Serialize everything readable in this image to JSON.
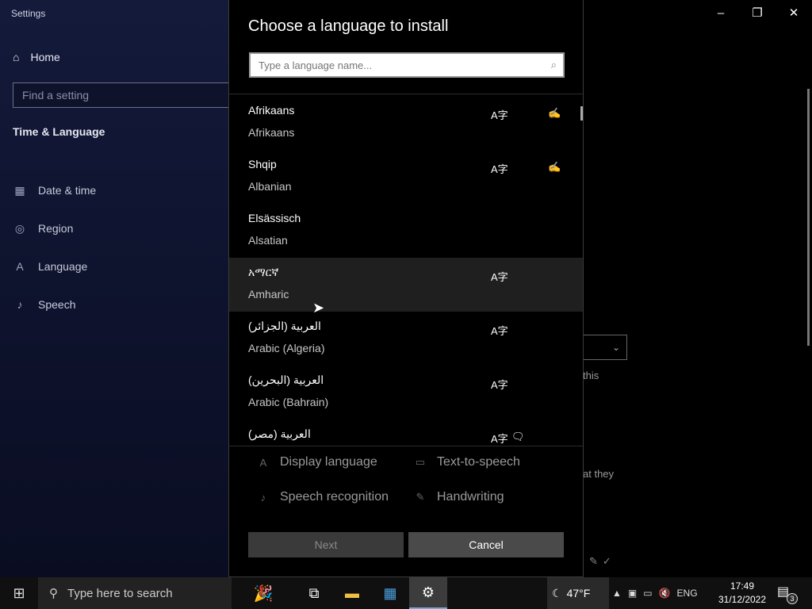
{
  "settings": {
    "app_title": "Settings",
    "home_label": "Home",
    "search_placeholder": "Find a setting",
    "section_title": "Time & Language",
    "nav": [
      {
        "label": "Date & time",
        "icon": "calendar-clock-icon"
      },
      {
        "label": "Region",
        "icon": "globe-icon"
      },
      {
        "label": "Language",
        "icon": "language-icon"
      },
      {
        "label": "Speech",
        "icon": "microphone-icon"
      }
    ],
    "partial_text_1": "this",
    "partial_text_2": "at they"
  },
  "dialog": {
    "title": "Choose a language to install",
    "search_placeholder": "Type a language name...",
    "languages": [
      {
        "native": "Afrikaans",
        "english": "Afrikaans",
        "display": true,
        "tts": false,
        "handwriting": true
      },
      {
        "native": "Shqip",
        "english": "Albanian",
        "display": true,
        "tts": false,
        "handwriting": true
      },
      {
        "native": "Elsässisch",
        "english": "Alsatian",
        "display": false,
        "tts": false,
        "handwriting": false
      },
      {
        "native": "አማርኛ",
        "english": "Amharic",
        "display": true,
        "tts": false,
        "handwriting": false
      },
      {
        "native": "العربية (الجزائر)",
        "english": "Arabic (Algeria)",
        "display": true,
        "tts": false,
        "handwriting": false
      },
      {
        "native": "العربية (البحرين)",
        "english": "Arabic (Bahrain)",
        "display": true,
        "tts": false,
        "handwriting": false
      },
      {
        "native": "العربية (مصر)",
        "english": "",
        "display": true,
        "tts": true,
        "handwriting": false
      }
    ],
    "legend": {
      "display_language": "Display language",
      "text_to_speech": "Text-to-speech",
      "speech_recognition": "Speech recognition",
      "handwriting": "Handwriting"
    },
    "next_label": "Next",
    "cancel_label": "Cancel"
  },
  "taskbar": {
    "search_placeholder": "Type here to search",
    "temperature": "47°F",
    "input_language": "ENG",
    "time": "17:49",
    "date": "31/12/2022",
    "notification_count": "3"
  }
}
